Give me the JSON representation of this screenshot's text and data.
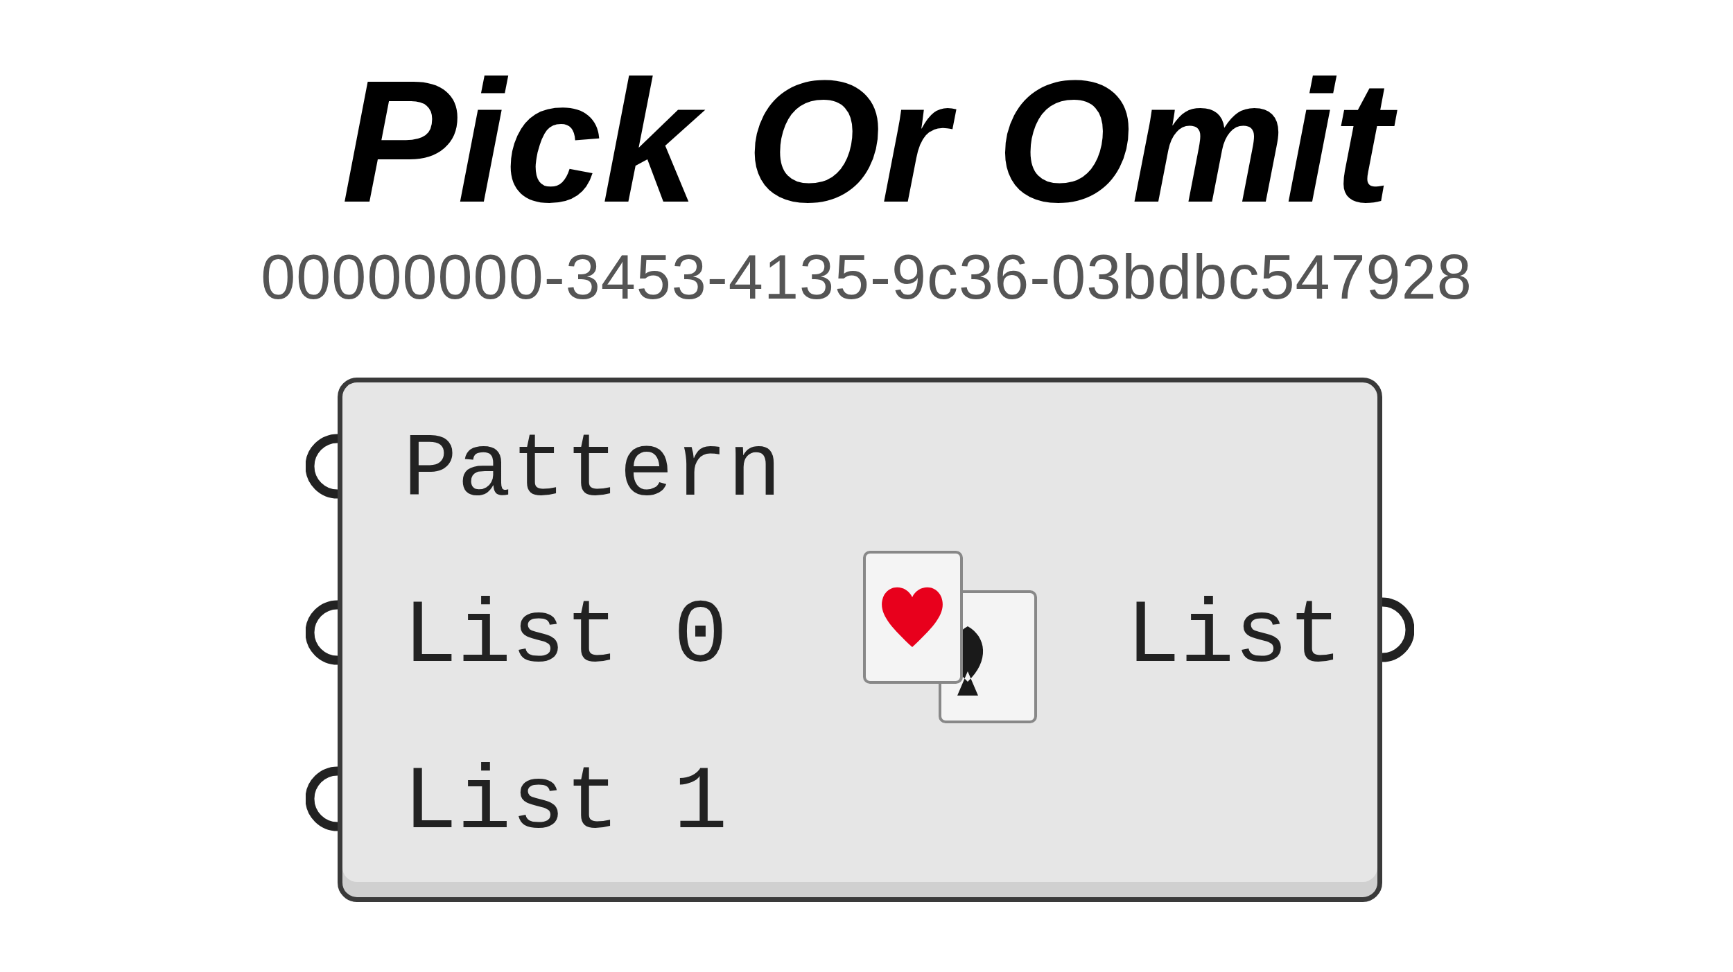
{
  "title": "Pick Or Omit",
  "guid": "00000000-3453-4135-9c36-03bdbc547928",
  "component": {
    "inputs": [
      "Pattern",
      "List 0",
      "List 1"
    ],
    "outputs": [
      "List"
    ]
  }
}
